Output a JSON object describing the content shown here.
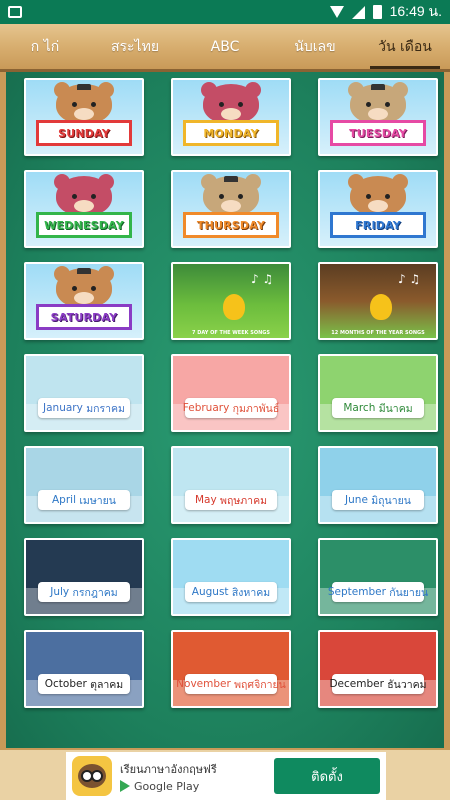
{
  "status": {
    "time": "16:49 น.",
    "icons": [
      "gallery-icon",
      "wifi-icon",
      "signal-icon",
      "battery-icon"
    ]
  },
  "tabs": [
    {
      "label": "ก ไก่",
      "active": false
    },
    {
      "label": "สระไทย",
      "active": false
    },
    {
      "label": "ABC",
      "active": false
    },
    {
      "label": "นับเลข",
      "active": false
    },
    {
      "label": "วัน เดือน",
      "active": true
    }
  ],
  "days": [
    {
      "label": "SUNDAY",
      "bear": "#c98a52",
      "color": "#e23a3a",
      "shadow": "#7a1515"
    },
    {
      "label": "MONDAY",
      "bear": "#c44d66",
      "color": "#f0b62a",
      "shadow": "#8a5a0d"
    },
    {
      "label": "TUESDAY",
      "bear": "#c7a77a",
      "color": "#e64aa4",
      "shadow": "#7a1c5a"
    },
    {
      "label": "WEDNESDAY",
      "bear": "#c44d66",
      "color": "#33b54a",
      "shadow": "#15602a"
    },
    {
      "label": "THURSDAY",
      "bear": "#c7a77a",
      "color": "#f08a2a",
      "shadow": "#7a3c0d"
    },
    {
      "label": "FRIDAY",
      "bear": "#c98a52",
      "color": "#2f77d0",
      "shadow": "#123d7a"
    },
    {
      "label": "SATURDAY",
      "bear": "#c98a52",
      "color": "#8a3cc4",
      "shadow": "#451a6a"
    }
  ],
  "songs": [
    {
      "caption": "7 DAY OF THE WEEK SONGS"
    },
    {
      "caption": "12 MONTHS OF THE YEAR SONGS"
    }
  ],
  "months": [
    {
      "en": "January",
      "th": "มกราคม",
      "color": "#3d74c7",
      "bg": "#bfe4ef"
    },
    {
      "en": "February",
      "th": "กุมภาพันธ์",
      "color": "#e0513a",
      "bg": "#f7a7a5"
    },
    {
      "en": "March",
      "th": "มีนาคม",
      "color": "#2f8a3a",
      "bg": "#8ed36f"
    },
    {
      "en": "April",
      "th": "เมษายน",
      "color": "#2d77c6",
      "bg": "#a9d6e6"
    },
    {
      "en": "May",
      "th": "พฤษภาคม",
      "color": "#d6392c",
      "bg": "#bfe6f1"
    },
    {
      "en": "June",
      "th": "มิถุนายน",
      "color": "#2d77c6",
      "bg": "#8fd1ea"
    },
    {
      "en": "July",
      "th": "กรกฎาคม",
      "color": "#2d77c6",
      "bg": "#243a52"
    },
    {
      "en": "August",
      "th": "สิงหาคม",
      "color": "#2d77c6",
      "bg": "#9fdcf2"
    },
    {
      "en": "September",
      "th": "กันยายน",
      "color": "#2d77c6",
      "bg": "#2c8f68"
    },
    {
      "en": "October",
      "th": "ตุลาคม",
      "color": "#222222",
      "bg": "#4c6fa0"
    },
    {
      "en": "November",
      "th": "พฤศจิกายน",
      "color": "#e0513a",
      "bg": "#e05a32"
    },
    {
      "en": "December",
      "th": "ธันวาคม",
      "color": "#222222",
      "bg": "#d9473a"
    }
  ],
  "ad": {
    "title": "เรียนภาษาอังกฤษฟรี",
    "store": "Google Play",
    "button": "ติดตั้ง"
  }
}
